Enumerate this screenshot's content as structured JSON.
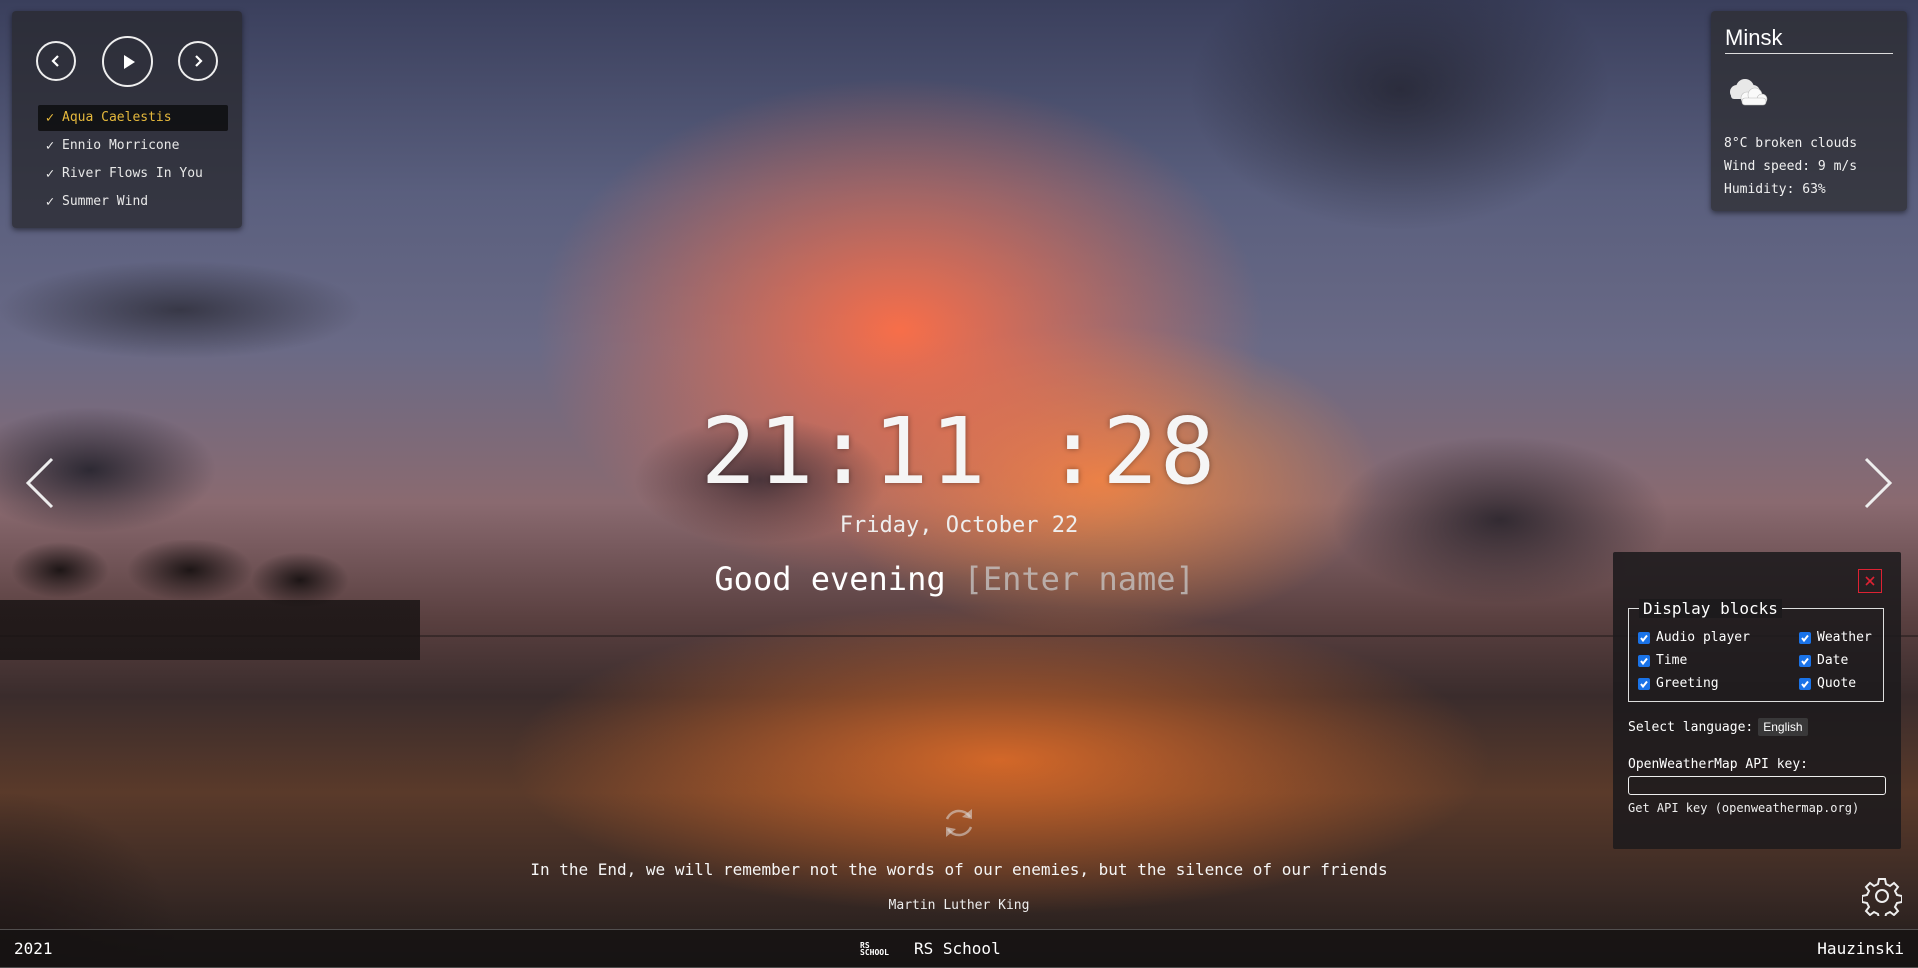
{
  "player": {
    "tracks": [
      {
        "title": "Aqua Caelestis",
        "active": true
      },
      {
        "title": "Ennio Morricone",
        "active": false
      },
      {
        "title": "River Flows In You",
        "active": false
      },
      {
        "title": "Summer Wind",
        "active": false
      }
    ],
    "check": "✓",
    "icons": {
      "prev": "prev-icon",
      "play": "play-icon",
      "next": "next-icon"
    },
    "active_color": "#e5b83c"
  },
  "weather": {
    "city": "Minsk",
    "icon": "broken-clouds-icon",
    "temp_desc": "8°C  broken clouds",
    "wind": "Wind speed: 9 m/s",
    "humidity": "Humidity: 63%"
  },
  "time": "21:11:28",
  "date": "Friday, October 22",
  "greeting": {
    "text": "Good evening",
    "name_placeholder": "[Enter name]",
    "name_value": ""
  },
  "quote": {
    "text": "In the End, we will remember not the words of our enemies, but the silence of our friends",
    "author": "Martin Luther King"
  },
  "settings": {
    "legend": "Display blocks",
    "options": {
      "audio": "Audio player",
      "weather": "Weather",
      "time": "Time",
      "date": "Date",
      "greeting": "Greeting",
      "quote": "Quote"
    },
    "checked": true,
    "language_label": "Select language:",
    "language_value": "English",
    "api_label": "OpenWeatherMap API key:",
    "api_value": "",
    "api_link": "Get API key (openweathermap.org)",
    "close_color": "#d23"
  },
  "footer": {
    "year": "2021",
    "school_logo": "RS SCHOOL",
    "school": "RS School",
    "author": "Hauzinski"
  }
}
